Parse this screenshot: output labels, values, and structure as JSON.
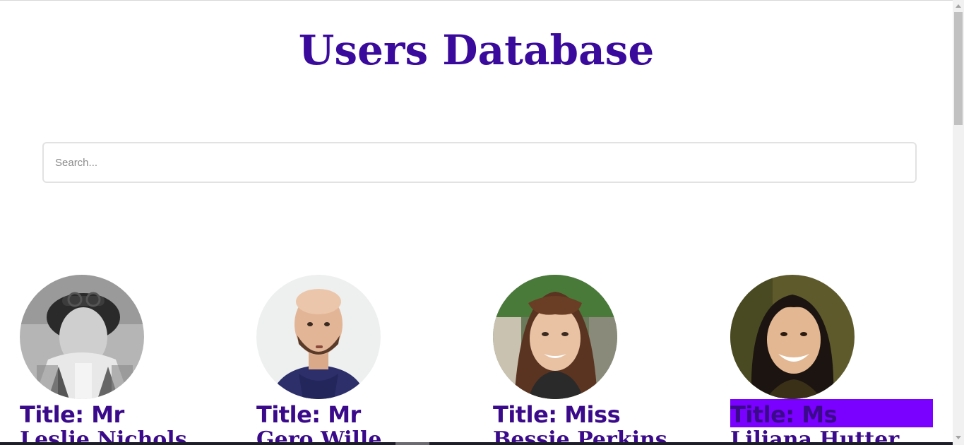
{
  "header": {
    "title": "Users Database"
  },
  "search": {
    "placeholder": "Search...",
    "value": ""
  },
  "users": [
    {
      "title": "Title: Mr",
      "name": "Leslie Nichols",
      "highlighted": false
    },
    {
      "title": "Title: Mr",
      "name": "Gero Wille",
      "highlighted": false
    },
    {
      "title": "Title: Miss",
      "name": "Bessie Perkins",
      "highlighted": false
    },
    {
      "title": "Title: Ms",
      "name": "Liliana Hutter",
      "highlighted": true
    }
  ],
  "colors": {
    "title": "#3a0a9c",
    "text": "#3a0a8a",
    "highlight": "#7a00ff"
  }
}
